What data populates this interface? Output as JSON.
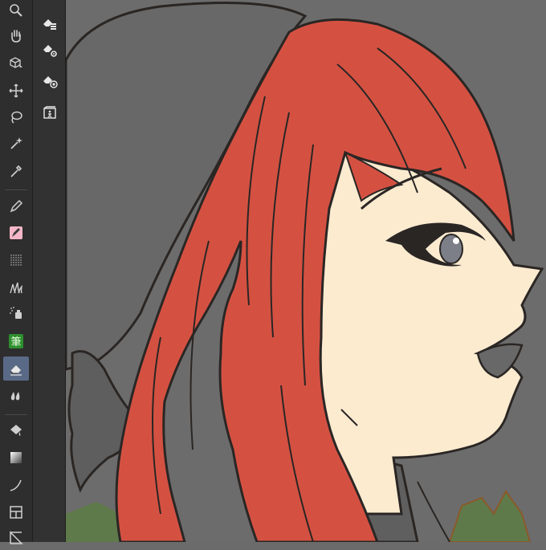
{
  "toolbar": {
    "tools": [
      {
        "name": "zoom-icon",
        "active": false
      },
      {
        "name": "hand-icon",
        "active": false
      },
      {
        "name": "rotate-view-icon",
        "active": false
      },
      {
        "name": "move-icon",
        "active": false
      },
      {
        "name": "lasso-icon",
        "active": false
      },
      {
        "name": "magic-wand-icon",
        "active": false
      },
      {
        "name": "eyedropper-icon",
        "active": false
      },
      {
        "name": "pen-icon",
        "active": false
      },
      {
        "name": "pencil-icon",
        "active": false
      },
      {
        "name": "airbrush-icon",
        "active": false
      },
      {
        "name": "decoration-icon",
        "active": false
      },
      {
        "name": "spray-icon",
        "active": false
      },
      {
        "name": "brush-icon",
        "active": false
      },
      {
        "name": "eraser-icon",
        "active": true
      },
      {
        "name": "blend-icon",
        "active": false
      },
      {
        "name": "fill-icon",
        "active": false
      },
      {
        "name": "gradient-icon",
        "active": false
      },
      {
        "name": "figure-icon",
        "active": false
      },
      {
        "name": "frame-icon",
        "active": false
      },
      {
        "name": "ruler-icon",
        "active": false
      }
    ],
    "brush_tool_label": "筆"
  },
  "subtools": [
    {
      "name": "eraser-layer-icon"
    },
    {
      "name": "eraser-settings-icon"
    },
    {
      "name": "eraser-target-icon"
    },
    {
      "name": "material-folder-icon"
    }
  ],
  "colors": {
    "hair": "#d45142",
    "skin": "#fdebd0",
    "hat": "#686868",
    "background": "#6c6c6c",
    "line": "#2a2624",
    "leaf": "#5f7a4a",
    "accent": "#5a6a86"
  }
}
